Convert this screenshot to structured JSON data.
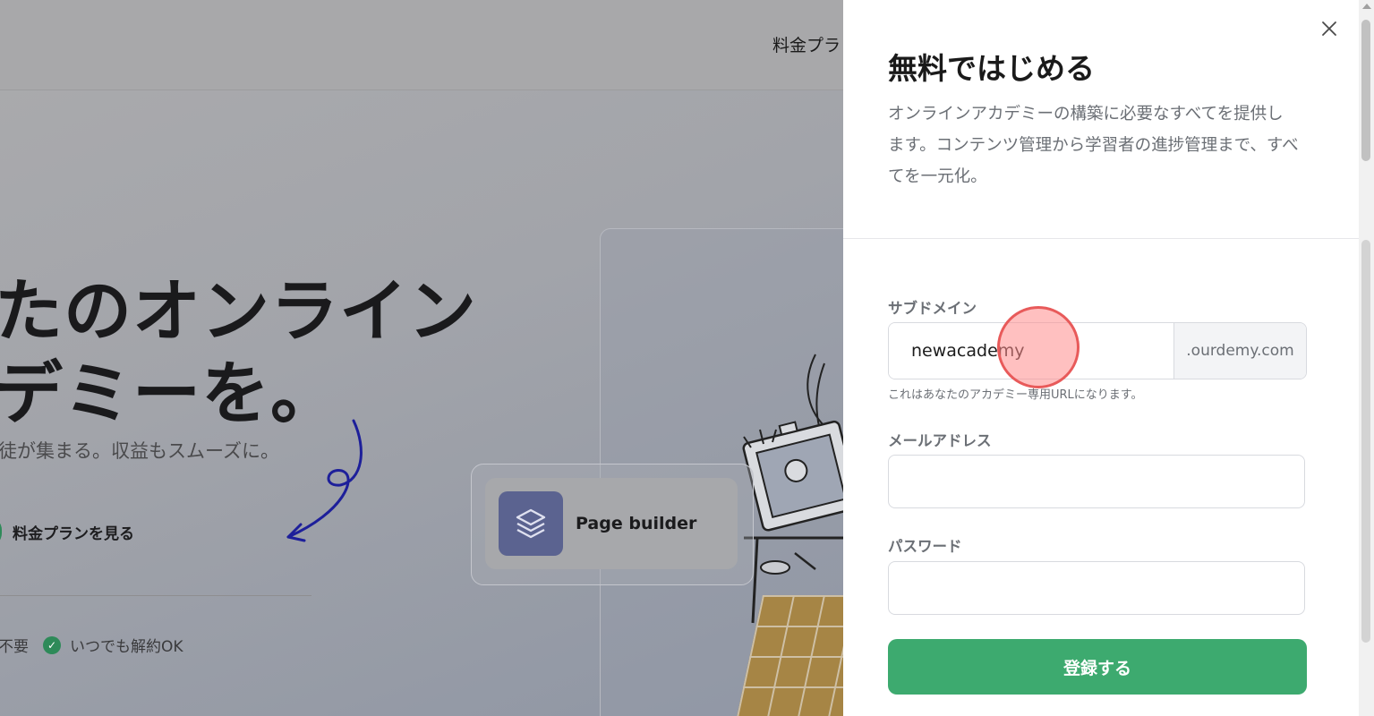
{
  "background": {
    "nav_item": "料金プラ",
    "hero_line1": "たのオンライン",
    "hero_line2": "デミーを。",
    "hero_subtitle": "徒が集まる。収益もスムーズに。",
    "pricing_link": "料金プランを見る",
    "feature_1": "不要",
    "feature_2": "いつでも解約OK",
    "page_builder_label": "Page builder"
  },
  "modal": {
    "title": "無料ではじめる",
    "description": "オンラインアカデミーの構築に必要なすべてを提供します。コンテンツ管理から学習者の進捗管理まで、すべてを一元化。",
    "subdomain": {
      "label": "サブドメイン",
      "value": "newacademy",
      "suffix": ".ourdemy.com",
      "hint": "これはあなたのアカデミー専用URLになります。"
    },
    "email": {
      "label": "メールアドレス",
      "value": ""
    },
    "password": {
      "label": "パスワード",
      "value": ""
    },
    "submit_label": "登録する"
  },
  "colors": {
    "accent": "#3daa6f",
    "overlay": "#a9a9ab"
  }
}
